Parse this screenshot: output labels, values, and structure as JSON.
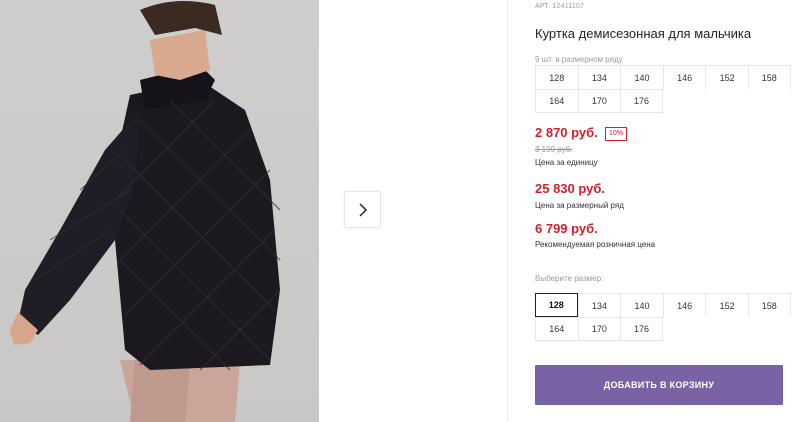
{
  "product": {
    "article": "АРТ. 12411107",
    "title": "Куртка демисезонная для мальчика"
  },
  "pack": {
    "label": "9 шт. в размерном ряду",
    "sizes": [
      "128",
      "134",
      "140",
      "146",
      "152",
      "158",
      "164",
      "170",
      "176"
    ]
  },
  "pricing": {
    "unit_price": "2 870 руб.",
    "discount": "10%",
    "old_price": "3 190 руб.",
    "unit_caption": "Цена за единицу",
    "pack_price": "25 830 руб.",
    "pack_caption": "Цена за размерный ряд",
    "rrp_price": "6 799 руб.",
    "rrp_caption": "Рекомендуемая розничная цена",
    "accent_color": "#d0202c"
  },
  "size_select": {
    "label": "Выберите размер:",
    "sizes": [
      "128",
      "134",
      "140",
      "146",
      "152",
      "158",
      "164",
      "170",
      "176"
    ],
    "selected": "128"
  },
  "cart": {
    "button_label": "ДОБАВИТЬ В КОРЗИНУ",
    "button_color": "#7a63a5"
  },
  "gallery": {
    "next_icon": "chevron-right-icon",
    "photo": "boy-in-quilted-black-jacket"
  }
}
